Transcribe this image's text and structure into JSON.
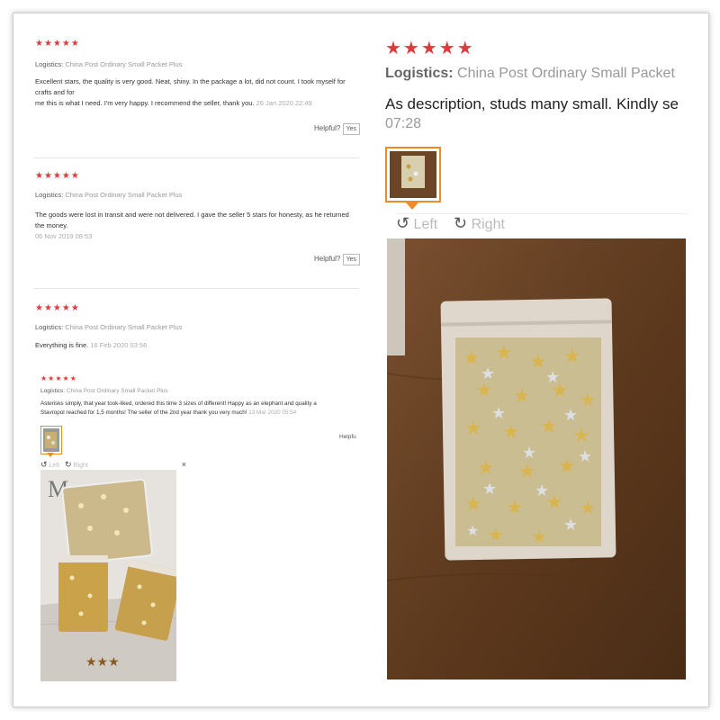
{
  "reviews_left": [
    {
      "stars": "★★★★★",
      "logistics_label": "Logistics:",
      "logistics_value": "China Post Ordinary Small Packet Plus",
      "text_line1": "Excellent stars, the quality is very good. Neat, shiny. In the package a lot, did not count. I took myself for crafts and for",
      "text_line2": "me this is what I need. I'm very happy. I recommend the seller, thank you.",
      "date": "26 Jan 2020 22:49",
      "helpful_label": "Helpful?",
      "yes_label": "Yes"
    },
    {
      "stars": "★★★★★",
      "logistics_label": "Logistics:",
      "logistics_value": "China Post Ordinary Small Packet Plus",
      "text_line1": "The goods were lost in transit and were not delivered. I gave the seller 5 stars for honesty, as he returned the money.",
      "date": "06 Nov 2019 08:53",
      "helpful_label": "Helpful?",
      "yes_label": "Yes"
    },
    {
      "stars": "★★★★★",
      "logistics_label": "Logistics:",
      "logistics_value": "China Post Ordinary Small Packet Plus",
      "text_line1": "Everything is fine.",
      "date": "16 Feb 2020 03:56"
    },
    {
      "stars": "★★★★★",
      "logistics_label": "Logistics:",
      "logistics_value": "China Post Ordinary Small Packet Plus",
      "text_line1": "Asterisks simply, that year took-liked, ordered this time 3 sizes of different! Happy as an elephant and quality a",
      "text_line2": "Stavropol reached for 1,5 months! The seller of the 2nd year thank you very much!",
      "date": "13 Mar 2020 05:54",
      "helpful_label": "Helpfu",
      "left_label": "Left",
      "right_label": "Right",
      "close_label": "×"
    }
  ],
  "review_right": {
    "stars": "★★★★★",
    "logistics_label": "Logistics:",
    "logistics_value": "China Post Ordinary Small Packet",
    "text": "As description, studs many small. Kindly se",
    "time": "07:28",
    "left_label": "Left",
    "right_label": "Right"
  },
  "icons": {
    "rotate_left": "rotate-left-icon",
    "rotate_right": "rotate-right-icon"
  },
  "colors": {
    "star_red": "#e4393c",
    "thumb_border": "#f08a24"
  }
}
